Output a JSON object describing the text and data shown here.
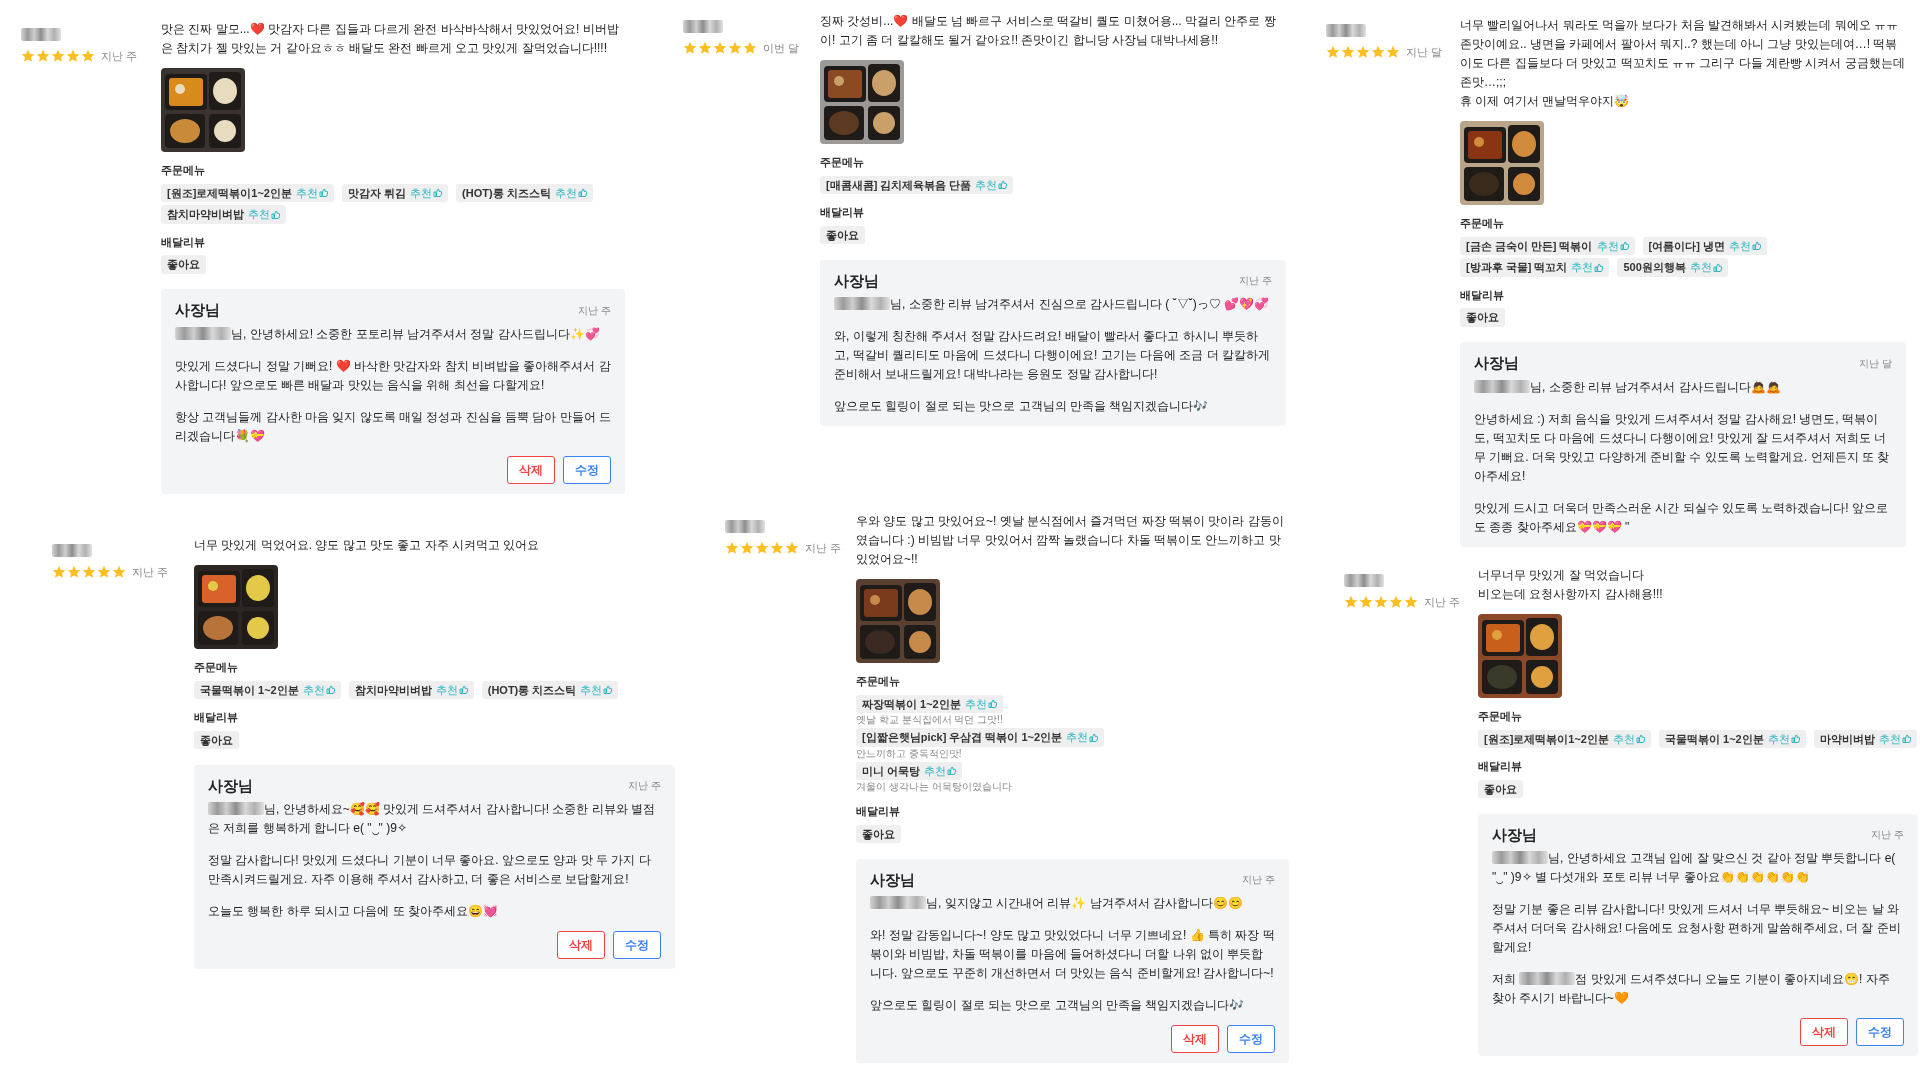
{
  "reviews": [
    {
      "stars": 5,
      "date": "지난 주",
      "text": [
        "맛은 진짜 말모...❤️ 맛감자 다른 집들과 다르게 완전 바삭바삭해서 맛있었어요! 비버밥은 참치가 젤 맛있는 거 같아요ㅎㅎ 배달도 완전 빠르게 오고 맛있게 잘먹었습니다!!!!"
      ],
      "photo": {
        "kind": "picture"
      },
      "menu_label": "주문메뉴",
      "menus": [
        {
          "name": "[원조]로제떡볶이1~2인분",
          "tag": "추천"
        },
        {
          "name": "맛감자 튀김",
          "tag": "추천"
        },
        {
          "name": "(HOT)롱 치즈스틱",
          "tag": "추천"
        },
        {
          "name": "참치마약비벼밥",
          "tag": "추천"
        }
      ],
      "delivery_label": "배달리뷰",
      "delivery": "좋아요",
      "reply": {
        "author": "사장님",
        "date": "지난 주",
        "paragraphs": [
          [
            {
              "kind": "redacted"
            },
            {
              "kind": "text",
              "text": "님, 안녕하세요! 소중한 포토리뷰 남겨주셔서 정말 감사드립니다✨💞"
            }
          ],
          [
            {
              "kind": "text",
              "text": "맛있게 드셨다니 정말 기뻐요! ❤️ 바삭한 맛감자와 참치 비벼밥을 좋아해주셔서 감사합니다! 앞으로도 빠른 배달과 맛있는 음식을 위해 최선을 다할게요!"
            }
          ],
          [
            {
              "kind": "text",
              "text": "항상 고객님들께 감사한 마음 잊지 않도록 매일 정성과 진심을 듬뿍 담아 만들어 드리겠습니다💐💝"
            }
          ]
        ],
        "buttons": [
          {
            "label": "삭제",
            "kind": "delete"
          },
          {
            "label": "수정",
            "kind": "edit"
          }
        ]
      }
    },
    {
      "stars": 5,
      "date": "지난 주",
      "text": [
        "너무 맛있게 먹었어요. 양도 많고 맛도 좋고 자주 시켜먹고 있어요"
      ],
      "photo": {
        "kind": "picture"
      },
      "menu_label": "주문메뉴",
      "menus": [
        {
          "name": "국물떡볶이 1~2인분",
          "tag": "추천"
        },
        {
          "name": "참치마약비벼밥",
          "tag": "추천"
        },
        {
          "name": "(HOT)롱 치즈스틱",
          "tag": "추천"
        }
      ],
      "delivery_label": "배달리뷰",
      "delivery": "좋아요",
      "reply": {
        "author": "사장님",
        "date": "지난 주",
        "paragraphs": [
          [
            {
              "kind": "redacted"
            },
            {
              "kind": "text",
              "text": "님, 안녕하세요~🥰🥰 맛있게 드셔주셔서 감사합니다! 소중한 리뷰와 별점은 저희를 행복하게 합니다 e( \"‿\" )9✧"
            }
          ],
          [
            {
              "kind": "text",
              "text": "정말 감사합니다! 맛있게 드셨다니 기분이 너무 좋아요. 앞으로도 양과 맛 두 가지 다 만족시켜드릴게요. 자주 이용해 주셔서 감사하고, 더 좋은 서비스로 보답할게요!"
            }
          ],
          [
            {
              "kind": "text",
              "text": "오늘도 행복한 하루 되시고 다음에 또 찾아주세요😄💓"
            }
          ]
        ],
        "buttons": [
          {
            "label": "삭제",
            "kind": "delete"
          },
          {
            "label": "수정",
            "kind": "edit"
          }
        ]
      }
    },
    {
      "stars": 5,
      "date": "이번 달",
      "text": [
        "징짜 갓성비...❤️ 배달도 넘 빠르구 서비스로 떡갈비 퀄도 미쳤어용... 막걸리 안주로 짱이! 고기 좀 더 칼칼해도 될거 같아요!! 존맛이긴 합니당 사장님 대박나세용!!"
      ],
      "photo": {
        "kind": "picture"
      },
      "menu_label": "주문메뉴",
      "menus": [
        {
          "name": "[매콤새콤] 김치제육볶음 단품",
          "tag": "추천"
        }
      ],
      "delivery_label": "배달리뷰",
      "delivery": "좋아요",
      "reply": {
        "author": "사장님",
        "date": "지난 주",
        "paragraphs": [
          [
            {
              "kind": "redacted"
            },
            {
              "kind": "text",
              "text": "님, 소중한 리뷰 남겨주셔서 진심으로 감사드립니다 ( ˘▽˘)っ♡ 💕💖💞"
            }
          ],
          [
            {
              "kind": "text",
              "text": "와, 이렇게 칭찬해 주셔서 정말 감사드려요! 배달이 빨라서 좋다고 하시니 뿌듯하고, 떡갈비 퀄리티도 마음에 드셨다니 다행이에요! 고기는 다음에 조금 더 칼칼하게 준비해서 보내드릴게요! 대박나라는 응원도 정말 감사합니다!"
            }
          ],
          [
            {
              "kind": "text",
              "text": "앞으로도 힐링이 절로 되는 맛으로 고객님의 만족을 책임지겠습니다🎶"
            }
          ]
        ]
      }
    },
    {
      "stars": 5,
      "date": "지난 주",
      "text": [
        "우와 양도 많고 맛있어요~! 옛날 분식점에서 즐겨먹던 짜장 떡볶이 맛이라 감동이였습니다 :) 비빔밥 너무 맛있어서 깜짝 놀랬습니다 차돌 떡볶이도 안느끼하고 맛있었어요~!!"
      ],
      "photo": {
        "kind": "picture"
      },
      "menu_label": "주문메뉴",
      "menus": [
        {
          "name": "짜장떡볶이 1~2인분",
          "tag": "추천",
          "note": "옛날 학교 분식집에서 먹던 그맛!!"
        },
        {
          "name": "[입짧은햇님pick] 우삼겹 떡볶이 1~2인분",
          "tag": "추천",
          "note": "안느끼하고 중독적인맛!"
        },
        {
          "name": "미니 어묵탕",
          "tag": "추천",
          "note": "겨울이 생각나는 어묵탕이였습니다"
        }
      ],
      "delivery_label": "배달리뷰",
      "delivery": "좋아요",
      "reply": {
        "author": "사장님",
        "date": "지난 주",
        "paragraphs": [
          [
            {
              "kind": "redacted"
            },
            {
              "kind": "text",
              "text": "님, 잊지않고 시간내어 리뷰✨ 남겨주셔서 감사합니다😊😊"
            }
          ],
          [
            {
              "kind": "text",
              "text": "와! 정말 감동입니다~! 양도 많고 맛있었다니 너무 기쁘네요! 👍 특히 짜장 떡볶이와 비빔밥, 차돌 떡볶이를 마음에 들어하셨다니 더할 나위 없이 뿌듯합니다. 앞으로도 꾸준히 개선하면서 더 맛있는 음식 준비할게요! 감사합니다~!"
            }
          ],
          [
            {
              "kind": "text",
              "text": "앞으로도 힐링이 절로 되는 맛으로 고객님의 만족을 책임지겠습니다🎶"
            }
          ]
        ],
        "buttons": [
          {
            "label": "삭제",
            "kind": "delete"
          },
          {
            "label": "수정",
            "kind": "edit"
          }
        ]
      }
    },
    {
      "stars": 5,
      "date": "지난 달",
      "text": [
        "너무 빨리일어나서 뭐라도 먹을까 보다가 처음 발견해봐서 시켜봤는데 뭐에오 ㅠㅠ 존맛이예요.. 냉면을 카페에서 팔아서 뭐지..? 했는데 아니 그냥 맛있는데여…! 떡볶이도 다른 집들보다 더 맛있고 떡꼬치도 ㅠㅠ 그리구 다들 계란빵 시켜서 궁금했는데 존맛…;;;",
        "휴 이제 여기서 맨날먹우야지🤯"
      ],
      "photo": {
        "kind": "picture"
      },
      "menu_label": "주문메뉴",
      "menus": [
        {
          "name": "[금손 금숙이 만든] 떡볶이",
          "tag": "추천"
        },
        {
          "name": "[여름이다] 냉면",
          "tag": "추천"
        },
        {
          "name": "[방과후 국물] 떡꼬치",
          "tag": "추천"
        },
        {
          "name": "500원의행복",
          "tag": "추천"
        }
      ],
      "delivery_label": "배달리뷰",
      "delivery": "좋아요",
      "reply": {
        "author": "사장님",
        "date": "지난 달",
        "paragraphs": [
          [
            {
              "kind": "redacted"
            },
            {
              "kind": "text",
              "text": "님, 소중한 리뷰 남겨주셔서 감사드립니다🙇🙇"
            }
          ],
          [
            {
              "kind": "text",
              "text": "안녕하세요 :) 저희 음식을 맛있게 드셔주셔서 정말 감사해요! 냉면도, 떡볶이도, 떡꼬치도 다 마음에 드셨다니 다행이에요! 맛있게 잘 드셔주셔서 저희도 너무 기뻐요. 더욱 맛있고 다양하게 준비할 수 있도록 노력할게요. 언제든지 또 찾아주세요!"
            }
          ],
          [
            {
              "kind": "text",
              "text": "맛있게 드시고 더욱더 만족스러운 시간 되실수 있도록 노력하겠습니다! 앞으로도 종종 찾아주세요💝💝💝 \""
            }
          ]
        ]
      }
    },
    {
      "stars": 5,
      "date": "지난 주",
      "text": [
        "너무너무 맛있게 잘 먹었습니다",
        "비오는데 요청사항까지 감사해용!!!"
      ],
      "photo": {
        "kind": "picture"
      },
      "menu_label": "주문메뉴",
      "menus": [
        {
          "name": "[원조]로제떡볶이1~2인분",
          "tag": "추천"
        },
        {
          "name": "국물떡볶이 1~2인분",
          "tag": "추천"
        },
        {
          "name": "마약비벼밥",
          "tag": "추천"
        }
      ],
      "delivery_label": "배달리뷰",
      "delivery": "좋아요",
      "reply": {
        "author": "사장님",
        "date": "지난 주",
        "paragraphs": [
          [
            {
              "kind": "redacted"
            },
            {
              "kind": "text",
              "text": "님, 안녕하세요 고객님 입에 잘 맞으신 것 같아 정말 뿌듯합니다 e( \"‿\" )9✧ 별 다섯개와 포토 리뷰 너무 좋아요👏👏👏👏👏👏"
            }
          ],
          [
            {
              "kind": "text",
              "text": "정말 기분 좋은 리뷰 감사합니다! 맛있게 드셔서 너무 뿌듯해요~ 비오는 날 와주셔서 더더욱 감사해요! 다음에도 요청사항 편하게 말씀해주세요, 더 잘 준비할게요!"
            }
          ],
          [
            {
              "kind": "text",
              "text": "저희 "
            },
            {
              "kind": "redacted"
            },
            {
              "kind": "text",
              "text": "점 맛있게 드셔주셨다니 오늘도 기분이 좋아지네요😁! 자주 찾아 주시기 바랍니다~🧡"
            }
          ]
        ],
        "buttons": [
          {
            "label": "삭제",
            "kind": "delete"
          },
          {
            "label": "수정",
            "kind": "edit"
          }
        ]
      }
    }
  ]
}
